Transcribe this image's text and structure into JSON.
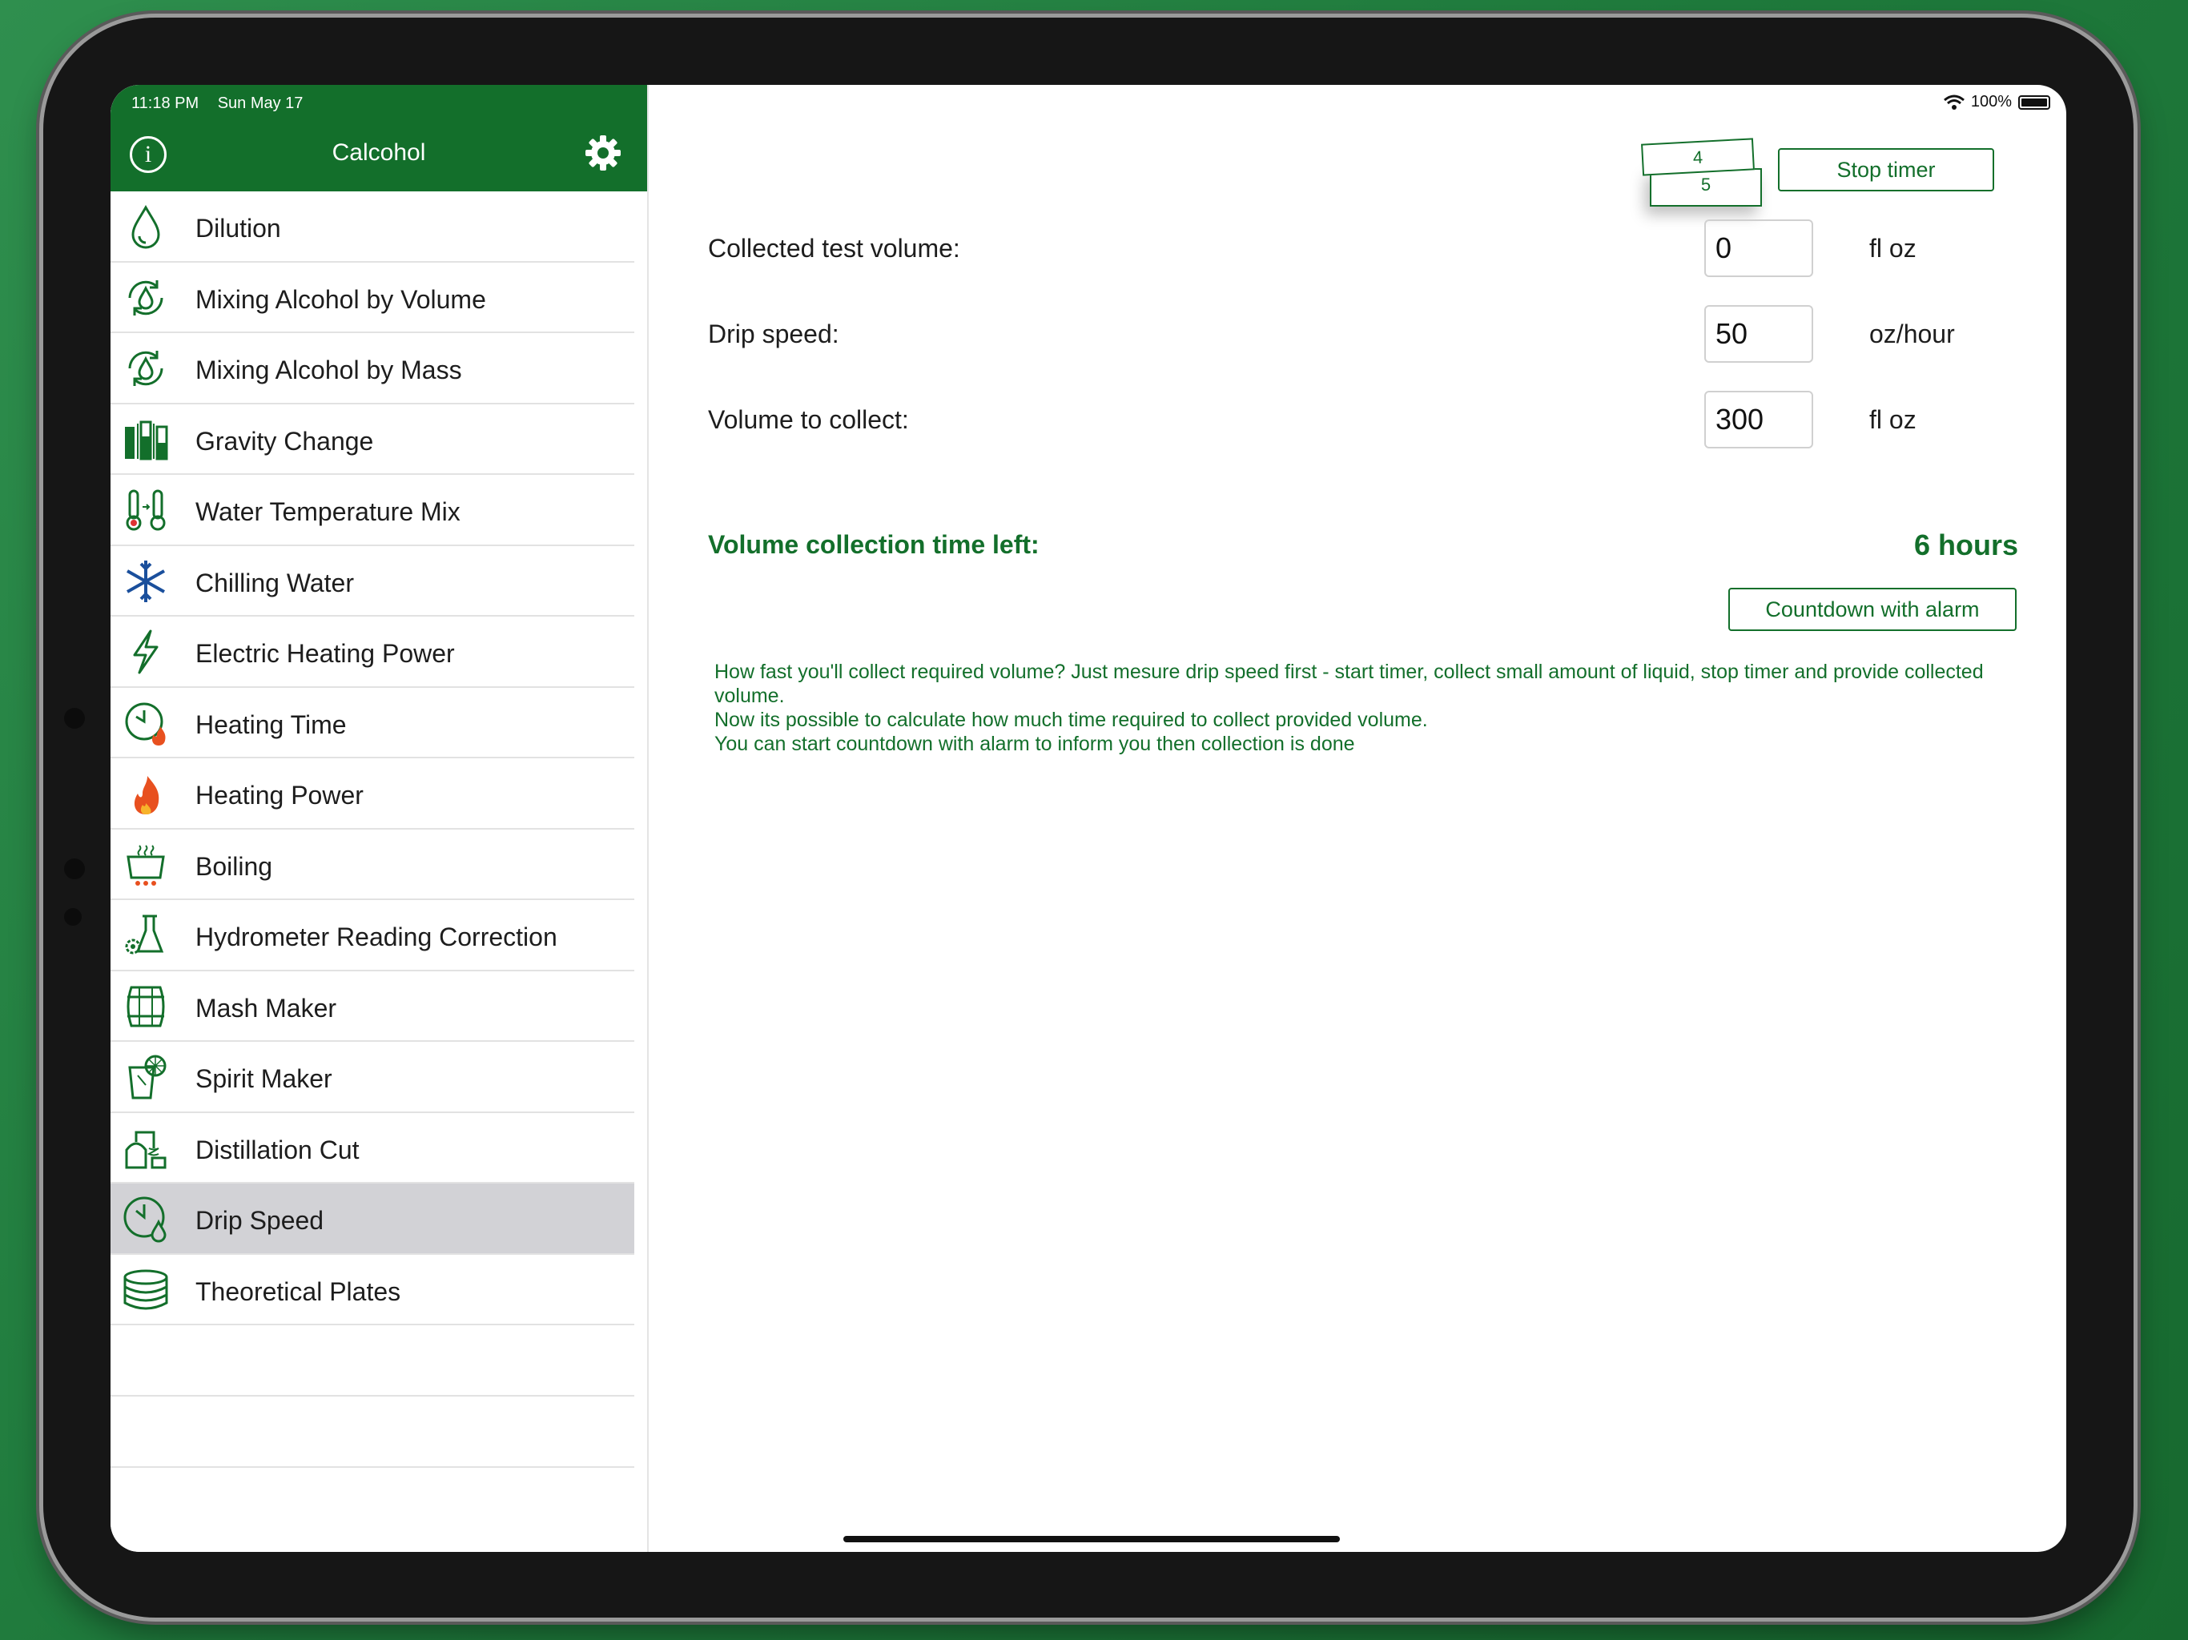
{
  "status": {
    "time": "11:18 PM",
    "date": "Sun May 17",
    "battery": "100%"
  },
  "nav": {
    "title": "Calcohol"
  },
  "sidebar": {
    "items": [
      {
        "label": "Dilution",
        "icon": "droplet-icon"
      },
      {
        "label": "Mixing Alcohol by Volume",
        "icon": "mix-volume-icon"
      },
      {
        "label": "Mixing Alcohol by Mass",
        "icon": "mix-mass-icon"
      },
      {
        "label": "Gravity Change",
        "icon": "gravity-icon"
      },
      {
        "label": "Water Temperature Mix",
        "icon": "thermometers-icon"
      },
      {
        "label": "Chilling Water",
        "icon": "snowflake-icon"
      },
      {
        "label": "Electric Heating Power",
        "icon": "lightning-icon"
      },
      {
        "label": "Heating Time",
        "icon": "clock-flame-icon"
      },
      {
        "label": "Heating Power",
        "icon": "flame-icon"
      },
      {
        "label": "Boiling",
        "icon": "boiling-pot-icon"
      },
      {
        "label": "Hydrometer Reading Correction",
        "icon": "flask-gear-icon"
      },
      {
        "label": "Mash Maker",
        "icon": "barrel-icon"
      },
      {
        "label": "Spirit Maker",
        "icon": "glass-lemon-icon"
      },
      {
        "label": "Distillation Cut",
        "icon": "still-icon"
      },
      {
        "label": "Drip Speed",
        "icon": "clock-drop-icon",
        "selected": true
      },
      {
        "label": "Theoretical Plates",
        "icon": "plates-icon"
      }
    ]
  },
  "timer": {
    "front": "4",
    "back": "5",
    "stop_label": "Stop timer"
  },
  "fields": {
    "collected": {
      "label": "Collected test volume:",
      "value": "0",
      "unit": "fl oz"
    },
    "drip": {
      "label": "Drip speed:",
      "value": "50",
      "unit": "oz/hour"
    },
    "volume": {
      "label": "Volume to collect:",
      "value": "300",
      "unit": "fl oz"
    }
  },
  "result": {
    "label": "Volume collection time left:",
    "value": "6 hours"
  },
  "countdown_label": "Countdown with alarm",
  "help": [
    "How fast you'll collect required volume? Just mesure drip speed first - start timer, collect small amount of liquid, stop timer and provide collected volume.",
    "Now its possible to calculate how much time required to collect provided volume.",
    "You can start countdown with alarm to inform you then collection is done"
  ],
  "colors": {
    "accent": "#136f2b",
    "selected_row": "#d2d2d6",
    "background": "#1f7a3c"
  }
}
